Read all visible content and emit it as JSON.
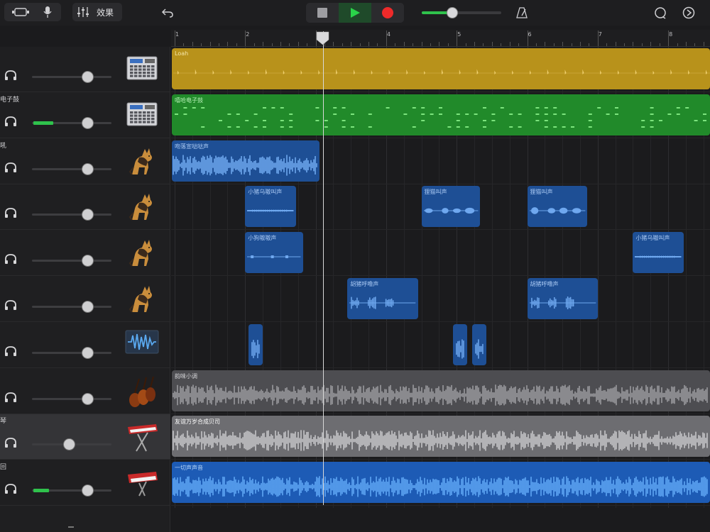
{
  "toolbar": {
    "fx_label": "效果",
    "icons": [
      "view-toggle-icon",
      "microphone-icon",
      "mixer-icon",
      "undo-icon",
      "stop-icon",
      "play-icon",
      "record-icon",
      "metronome-icon",
      "loop-icon",
      "settings-icon"
    ],
    "master_volume": 0.38
  },
  "ruler": {
    "bars": [
      "1",
      "2",
      "3",
      "4",
      "5",
      "6",
      "7",
      "8"
    ]
  },
  "tracks": [
    {
      "name": "",
      "meter": 0,
      "volume": 0.7,
      "icon": "drum-machine-icon",
      "selected": false
    },
    {
      "name": "电子鼓",
      "meter": 0.25,
      "volume": 0.7,
      "icon": "drum-machine-icon",
      "selected": false
    },
    {
      "name": "吼",
      "meter": 0,
      "volume": 0.7,
      "icon": "dog-icon",
      "selected": false
    },
    {
      "name": "",
      "meter": 0,
      "volume": 0.7,
      "icon": "dog-icon",
      "selected": false
    },
    {
      "name": "",
      "meter": 0,
      "volume": 0.7,
      "icon": "dog-icon",
      "selected": false
    },
    {
      "name": "",
      "meter": 0,
      "volume": 0.7,
      "icon": "dog-icon",
      "selected": false
    },
    {
      "name": "",
      "meter": 0,
      "volume": 0.7,
      "icon": "waveform-icon",
      "selected": false
    },
    {
      "name": "",
      "meter": 0,
      "volume": 0.7,
      "icon": "strings-icon",
      "selected": false
    },
    {
      "name": "琴",
      "meter": 0,
      "volume": 0.47,
      "icon": "keyboard-icon",
      "selected": true
    },
    {
      "name": "回",
      "meter": 0.2,
      "volume": 0.7,
      "icon": "synth-icon",
      "selected": false
    }
  ],
  "regions": [
    {
      "track": 0,
      "label": "Loah",
      "start": 1.0,
      "end": 8.6,
      "color": "#b8921b",
      "wave": "#f0d070",
      "style": "hits",
      "label_color": "#f5e6a8"
    },
    {
      "track": 1,
      "label": "嘻哈电子鼓",
      "start": 1.0,
      "end": 8.6,
      "color": "#218a2a",
      "wave": "#7ce47d",
      "style": "dashes",
      "label_color": "#b8f2b8"
    },
    {
      "track": 2,
      "label": "吻落宣哒哒声",
      "start": 1.0,
      "end": 3.05,
      "color": "#1e4f95",
      "wave": "#6fa8ef",
      "style": "wave",
      "label_color": "#a9c8f2"
    },
    {
      "track": 3,
      "label": "小猪乌嗷叫声",
      "start": 2.0,
      "end": 2.72,
      "color": "#1e4f95",
      "wave": "#6fa8ef",
      "style": "line",
      "label_color": "#a9c8f2"
    },
    {
      "track": 3,
      "label": "狸猫叫声",
      "start": 4.5,
      "end": 5.33,
      "color": "#1e4f95",
      "wave": "#6fa8ef",
      "style": "blobs",
      "label_color": "#a9c8f2"
    },
    {
      "track": 3,
      "label": "狸猫叫声",
      "start": 6.0,
      "end": 6.85,
      "color": "#1e4f95",
      "wave": "#6fa8ef",
      "style": "blobs",
      "label_color": "#a9c8f2"
    },
    {
      "track": 4,
      "label": "小狗嗷嗷声",
      "start": 2.0,
      "end": 2.82,
      "color": "#1e4f95",
      "wave": "#6fa8ef",
      "style": "dashline",
      "label_color": "#a9c8f2"
    },
    {
      "track": 4,
      "label": "小猪乌嗷叫声",
      "start": 7.5,
      "end": 8.22,
      "color": "#1e4f95",
      "wave": "#6fa8ef",
      "style": "line",
      "label_color": "#a9c8f2"
    },
    {
      "track": 5,
      "label": "胡猪呼噜声",
      "start": 3.45,
      "end": 4.45,
      "color": "#1e4f95",
      "wave": "#6fa8ef",
      "style": "chunks",
      "label_color": "#a9c8f2"
    },
    {
      "track": 5,
      "label": "胡猪呼噜声",
      "start": 6.0,
      "end": 7.0,
      "color": "#1e4f95",
      "wave": "#6fa8ef",
      "style": "chunks",
      "label_color": "#a9c8f2"
    },
    {
      "track": 6,
      "label": "",
      "start": 2.05,
      "end": 2.25,
      "color": "#1e4f95",
      "wave": "#6fa8ef",
      "style": "spike",
      "label_color": "#a9c8f2"
    },
    {
      "track": 6,
      "label": "",
      "start": 4.95,
      "end": 5.15,
      "color": "#1e4f95",
      "wave": "#6fa8ef",
      "style": "spike",
      "label_color": "#a9c8f2"
    },
    {
      "track": 6,
      "label": "",
      "start": 5.22,
      "end": 5.42,
      "color": "#1e4f95",
      "wave": "#6fa8ef",
      "style": "spike",
      "label_color": "#a9c8f2"
    },
    {
      "track": 7,
      "label": "韵味小调",
      "start": 1.0,
      "end": 8.6,
      "color": "#4d4d51",
      "wave": "#9a9a9e",
      "style": "wave",
      "label_color": "#d5d5d8"
    },
    {
      "track": 8,
      "label": "友谊万岁合成贝司",
      "start": 1.0,
      "end": 8.6,
      "color": "#6d6d71",
      "wave": "#c5c5c8",
      "style": "wave",
      "label_color": "#ffffff"
    },
    {
      "track": 9,
      "label": "一切声声音",
      "start": 1.0,
      "end": 8.6,
      "color": "#1d5bb5",
      "wave": "#5fa7f5",
      "style": "wave",
      "label_color": "#b5d4f8"
    }
  ],
  "playhead_bar": 3.1
}
